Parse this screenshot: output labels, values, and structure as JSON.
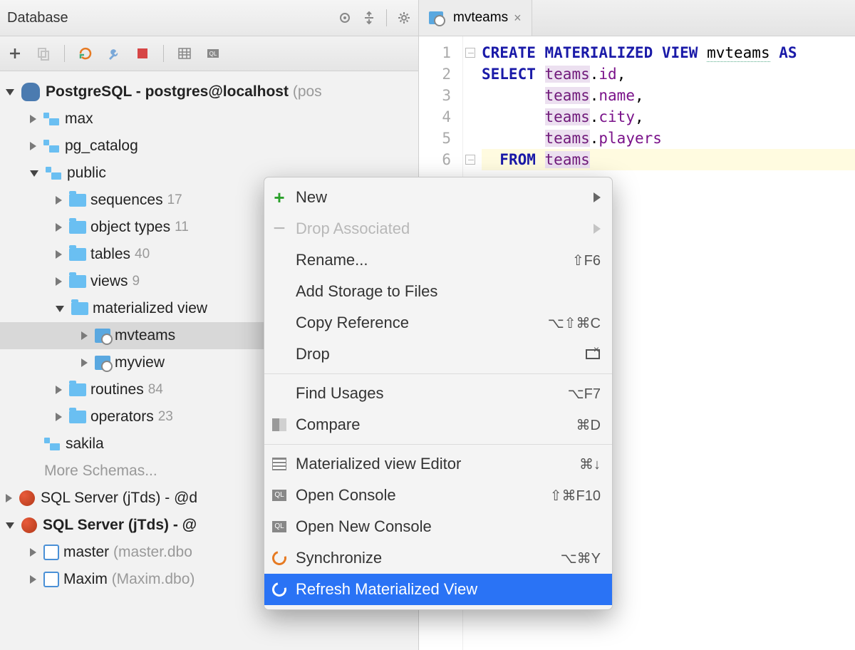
{
  "panel": {
    "title": "Database"
  },
  "tree": {
    "postgres": {
      "label": "PostgreSQL - postgres@localhost",
      "suffix": "(pos"
    },
    "schemas": {
      "max": "max",
      "pg_catalog": "pg_catalog",
      "public": "public",
      "sakila": "sakila"
    },
    "public_children": {
      "sequences": {
        "label": "sequences",
        "count": "17"
      },
      "object_types": {
        "label": "object types",
        "count": "11"
      },
      "tables": {
        "label": "tables",
        "count": "40"
      },
      "views": {
        "label": "views",
        "count": "9"
      },
      "materialized_views": {
        "label": "materialized view"
      },
      "routines": {
        "label": "routines",
        "count": "84"
      },
      "operators": {
        "label": "operators",
        "count": "23"
      }
    },
    "matviews": {
      "mvteams": "mvteams",
      "myview": "myview"
    },
    "more_schemas": "More Schemas...",
    "sqlserver1": {
      "label": "SQL Server (jTds) - @d"
    },
    "sqlserver2": {
      "label": "SQL Server (jTds) - @"
    },
    "master": {
      "label": "master",
      "suffix": "(master.dbo"
    },
    "maxim": {
      "label": "Maxim",
      "suffix": "(Maxim.dbo)"
    }
  },
  "editor": {
    "tab": "mvteams",
    "lines": [
      "1",
      "2",
      "3",
      "4",
      "5",
      "6"
    ],
    "sql": {
      "l1_kw1": "CREATE MATERIALIZED VIEW",
      "l1_id": "mvteams",
      "l1_kw2": "AS",
      "l2_kw": "SELECT",
      "l2_t": "teams",
      "l2_c": "id",
      "l3_t": "teams",
      "l3_c": "name",
      "l4_t": "teams",
      "l4_c": "city",
      "l5_t": "teams",
      "l5_c": "players",
      "l6_kw": "FROM",
      "l6_t": "teams"
    }
  },
  "ctx": {
    "new": "New",
    "drop_assoc": "Drop Associated",
    "rename": "Rename...",
    "rename_key": "⇧F6",
    "add_storage": "Add Storage to Files",
    "copy_ref": "Copy Reference",
    "copy_ref_key": "⌥⇧⌘C",
    "drop": "Drop",
    "find_usages": "Find Usages",
    "find_usages_key": "⌥F7",
    "compare": "Compare",
    "compare_key": "⌘D",
    "mv_editor": "Materialized view Editor",
    "mv_editor_key": "⌘↓",
    "open_console": "Open Console",
    "open_console_key": "⇧⌘F10",
    "open_new_console": "Open New Console",
    "synchronize": "Synchronize",
    "synchronize_key": "⌥⌘Y",
    "refresh_mv": "Refresh Materialized View"
  }
}
